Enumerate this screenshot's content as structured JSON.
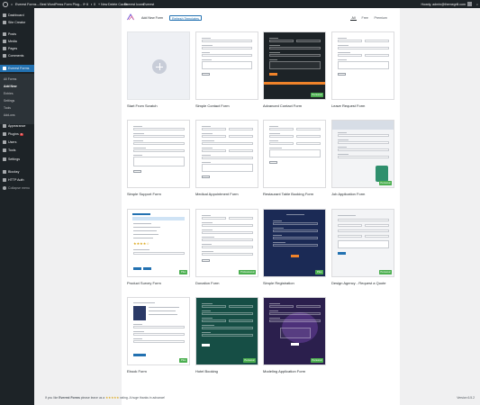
{
  "admin_bar": {
    "site_title": "Everest Forms – Best WordPress Form Plug...",
    "updates_count": "6",
    "comments_count": "0",
    "new_label": "+ New",
    "delete_cache": "Delete Cache",
    "everest_icons": "Everest Icons",
    "everest": "Everest",
    "greeting": "Howdy, admin@themegrill.com"
  },
  "sidebar": {
    "items": [
      {
        "label": "Dashboard",
        "icon": "dashboard-icon"
      },
      {
        "label": "Site Creator",
        "icon": "site-creator-icon"
      },
      {
        "label": "Posts",
        "icon": "pin-icon"
      },
      {
        "label": "Media",
        "icon": "media-icon"
      },
      {
        "label": "Pages",
        "icon": "pages-icon"
      },
      {
        "label": "Comments",
        "icon": "comment-icon"
      },
      {
        "label": "Everest Forms",
        "icon": "everest-forms-icon"
      },
      {
        "label": "Appearance",
        "icon": "brush-icon"
      },
      {
        "label": "Plugins",
        "icon": "plugin-icon",
        "badge": "6"
      },
      {
        "label": "Users",
        "icon": "users-icon"
      },
      {
        "label": "Tools",
        "icon": "wrench-icon"
      },
      {
        "label": "Settings",
        "icon": "settings-icon"
      },
      {
        "label": "Blocksy",
        "icon": "blocksy-icon"
      },
      {
        "label": "HTTP Auth",
        "icon": "lock-icon"
      },
      {
        "label": "Collapse menu",
        "icon": "collapse-icon"
      }
    ],
    "submenu": [
      "All Forms",
      "Add New",
      "Entries",
      "Settings",
      "Tools",
      "Add-ons"
    ]
  },
  "toolbar": {
    "page_title": "Add New Form",
    "refresh_label": "Refresh Templates",
    "filters": [
      "All",
      "Free",
      "Premium"
    ]
  },
  "templates": [
    {
      "title": "Start From Scratch",
      "badge": ""
    },
    {
      "title": "Simple Contact Form",
      "badge": ""
    },
    {
      "title": "Advanced Contact Form",
      "badge": "Personal"
    },
    {
      "title": "Leave Request Form",
      "badge": ""
    },
    {
      "title": "Simple Support Form",
      "badge": ""
    },
    {
      "title": "Medical Appointment Form",
      "badge": ""
    },
    {
      "title": "Restaurant Table Booking Form",
      "badge": ""
    },
    {
      "title": "Job Application Form",
      "badge": "Personal"
    },
    {
      "title": "Product Survey Form",
      "badge": "Plus"
    },
    {
      "title": "Donation Form",
      "badge": "Professional"
    },
    {
      "title": "Simple Registration",
      "badge": "Plus"
    },
    {
      "title": "Design Agency - Request a Quote",
      "badge": "Personal"
    },
    {
      "title": "Ebook Form",
      "badge": "Plus"
    },
    {
      "title": "Hotel Booking",
      "badge": "Personal"
    },
    {
      "title": "Modeling Application Form",
      "badge": "Personal"
    }
  ],
  "footer": {
    "prefix": "If you like",
    "brand": "Everest Forms",
    "middle": "please leave us a",
    "stars": "★★★★★",
    "suffix": "rating. A huge thanks in advance!",
    "version": "Version 6.5.2"
  },
  "colors": {
    "admin_dark": "#1d2327",
    "wp_blue": "#2271b1",
    "badge_green": "#4caf50"
  }
}
